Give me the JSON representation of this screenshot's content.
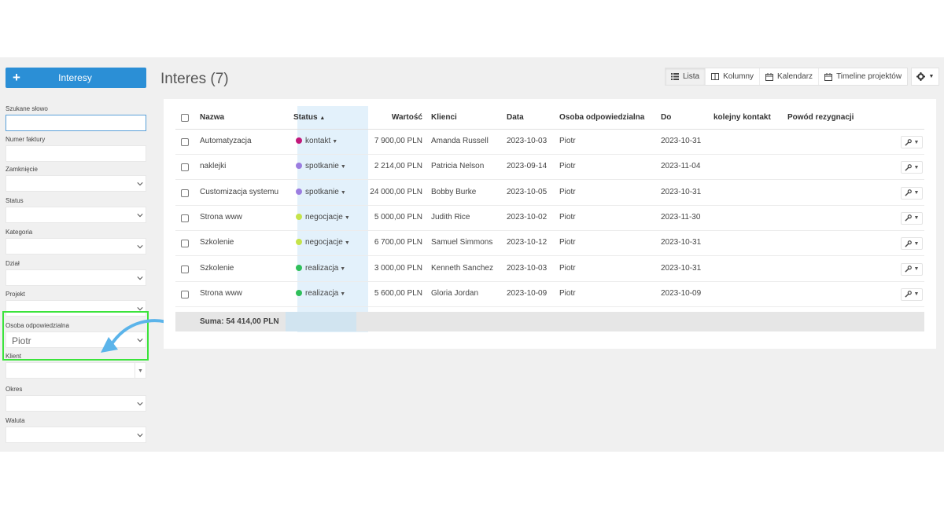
{
  "sidebar": {
    "new_button": {
      "icon": "plus-icon",
      "label": "Interesy"
    },
    "fields": [
      {
        "label": "Szukane słowo",
        "value": "",
        "type": "text"
      },
      {
        "label": "Numer faktury",
        "value": "",
        "type": "text"
      },
      {
        "label": "Zamknięcie",
        "value": "",
        "type": "select"
      },
      {
        "label": "Status",
        "value": "",
        "type": "select"
      },
      {
        "label": "Kategoria",
        "value": "",
        "type": "select"
      },
      {
        "label": "Dział",
        "value": "",
        "type": "select"
      },
      {
        "label": "Projekt",
        "value": "",
        "type": "select"
      },
      {
        "label": "Osoba odpowiedzialna",
        "value": "Piotr",
        "type": "select"
      },
      {
        "label": "Klient",
        "value": "",
        "type": "combo"
      },
      {
        "label": "Okres",
        "value": "",
        "type": "select"
      },
      {
        "label": "Waluta",
        "value": "",
        "type": "select"
      }
    ]
  },
  "header": {
    "title": "Interes (7)",
    "views": [
      {
        "icon": "list-icon",
        "label": "Lista",
        "active": true
      },
      {
        "icon": "columns-icon",
        "label": "Kolumny",
        "active": false
      },
      {
        "icon": "calendar-icon",
        "label": "Kalendarz",
        "active": false
      },
      {
        "icon": "calendar-icon",
        "label": "Timeline projektów",
        "active": false
      }
    ],
    "settings_icon": "gear-icon"
  },
  "table": {
    "columns": {
      "name": "Nazwa",
      "status": "Status",
      "sort_indicator": "▲",
      "value": "Wartość",
      "client": "Klienci",
      "date": "Data",
      "owner": "Osoba odpowiedzialna",
      "due": "Do",
      "next_contact": "kolejny kontakt",
      "reason": "Powód rezygnacji"
    },
    "rows": [
      {
        "name": "Automatyzacja",
        "status": "kontakt",
        "status_color": "#c2187a",
        "value": "7 900,00 PLN",
        "client": "Amanda Russell",
        "date": "2023-10-03",
        "owner": "Piotr",
        "due": "2023-10-31"
      },
      {
        "name": "naklejki",
        "status": "spotkanie",
        "status_color": "#9b7de0",
        "value": "2 214,00 PLN",
        "client": "Patricia Nelson",
        "date": "2023-09-14",
        "owner": "Piotr",
        "due": "2023-11-04"
      },
      {
        "name": "Customizacja systemu",
        "status": "spotkanie",
        "status_color": "#9b7de0",
        "value": "24 000,00 PLN",
        "client": "Bobby Burke",
        "date": "2023-10-05",
        "owner": "Piotr",
        "due": "2023-10-31"
      },
      {
        "name": "Strona www",
        "status": "negocjacje",
        "status_color": "#c5e34a",
        "value": "5 000,00 PLN",
        "client": "Judith Rice",
        "date": "2023-10-02",
        "owner": "Piotr",
        "due": "2023-11-30"
      },
      {
        "name": "Szkolenie",
        "status": "negocjacje",
        "status_color": "#c5e34a",
        "value": "6 700,00 PLN",
        "client": "Samuel Simmons",
        "date": "2023-10-12",
        "owner": "Piotr",
        "due": "2023-10-31"
      },
      {
        "name": "Szkolenie",
        "status": "realizacja",
        "status_color": "#2fbf5a",
        "value": "3 000,00 PLN",
        "client": "Kenneth Sanchez",
        "date": "2023-10-03",
        "owner": "Piotr",
        "due": "2023-10-31"
      },
      {
        "name": "Strona www",
        "status": "realizacja",
        "status_color": "#2fbf5a",
        "value": "5 600,00 PLN",
        "client": "Gloria Jordan",
        "date": "2023-10-09",
        "owner": "Piotr",
        "due": "2023-10-09"
      }
    ],
    "sum_label": "Suma: 54 414,00 PLN",
    "row_action_icon": "wrench-icon"
  },
  "annotation": {
    "highlight_color": "#3be33b",
    "arrow_color": "#5bb4ea"
  }
}
